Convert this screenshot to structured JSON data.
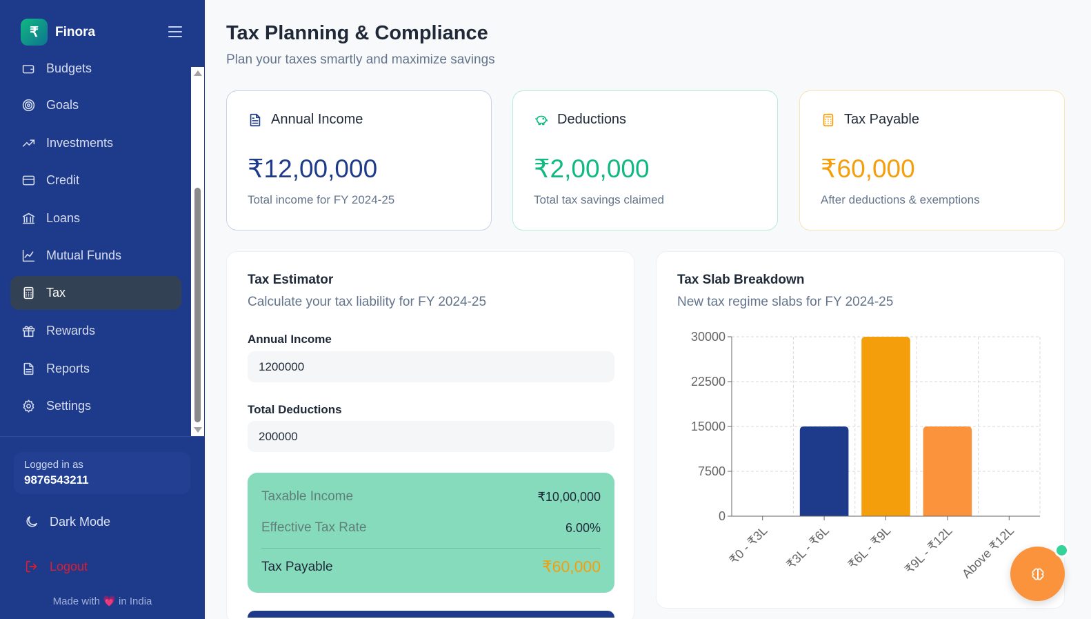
{
  "brand": {
    "logo_symbol": "₹",
    "name": "Finora"
  },
  "sidebar": {
    "items": [
      {
        "label": "Budgets",
        "icon": "wallet-icon"
      },
      {
        "label": "Goals",
        "icon": "target-icon"
      },
      {
        "label": "Investments",
        "icon": "trending-up-icon"
      },
      {
        "label": "Credit",
        "icon": "credit-card-icon"
      },
      {
        "label": "Loans",
        "icon": "bank-icon"
      },
      {
        "label": "Mutual Funds",
        "icon": "line-chart-icon"
      },
      {
        "label": "Tax",
        "icon": "calculator-icon",
        "active": true
      },
      {
        "label": "Rewards",
        "icon": "gift-icon"
      },
      {
        "label": "Reports",
        "icon": "document-icon"
      },
      {
        "label": "Settings",
        "icon": "gear-icon"
      }
    ],
    "user_label": "Logged in as",
    "user_phone": "9876543211",
    "dark_mode_label": "Dark Mode",
    "logout_label": "Logout",
    "made_with_prefix": "Made with",
    "made_with_heart": "💗",
    "made_with_suffix": "in India"
  },
  "header": {
    "title": "Tax Planning & Compliance",
    "subtitle": "Plan your taxes smartly and maximize savings"
  },
  "stats": [
    {
      "title": "Annual Income",
      "value": "₹12,00,000",
      "desc": "Total income for FY 2024-25",
      "color": "#1e3a8a",
      "border": "#c8d1e8",
      "icon": "document-icon"
    },
    {
      "title": "Deductions",
      "value": "₹2,00,000",
      "desc": "Total tax savings claimed",
      "color": "#10b981",
      "border": "#b8ecd9",
      "icon": "piggy-bank-icon"
    },
    {
      "title": "Tax Payable",
      "value": "₹60,000",
      "desc": "After deductions & exemptions",
      "color": "#f59e0b",
      "border": "#fbe3b5",
      "icon": "calculator-icon"
    }
  ],
  "estimator": {
    "title": "Tax Estimator",
    "subtitle": "Calculate your tax liability for FY 2024-25",
    "income_label": "Annual Income",
    "income_value": "1200000",
    "deductions_label": "Total Deductions",
    "deductions_value": "200000",
    "taxable_label": "Taxable Income",
    "taxable_value": "₹10,00,000",
    "rate_label": "Effective Tax Rate",
    "rate_value": "6.00%",
    "payable_label": "Tax Payable",
    "payable_value": "₹60,000"
  },
  "slab_panel": {
    "title": "Tax Slab Breakdown",
    "subtitle": "New tax regime slabs for FY 2024-25"
  },
  "chart_data": {
    "type": "bar",
    "categories": [
      "₹0 - ₹3L",
      "₹3L - ₹6L",
      "₹6L - ₹9L",
      "₹9L - ₹12L",
      "Above ₹12L"
    ],
    "values": [
      0,
      15000,
      30000,
      15000,
      0
    ],
    "bar_colors": [
      "#1e3a8a",
      "#1e3a8a",
      "#f59e0b",
      "#fb923c",
      "#fb923c"
    ],
    "yticks": [
      "0",
      "7500",
      "15000",
      "22500",
      "30000"
    ],
    "ylim": [
      0,
      30000
    ],
    "grid": true,
    "legend": false
  },
  "fab": {
    "icon": "brain-icon"
  }
}
